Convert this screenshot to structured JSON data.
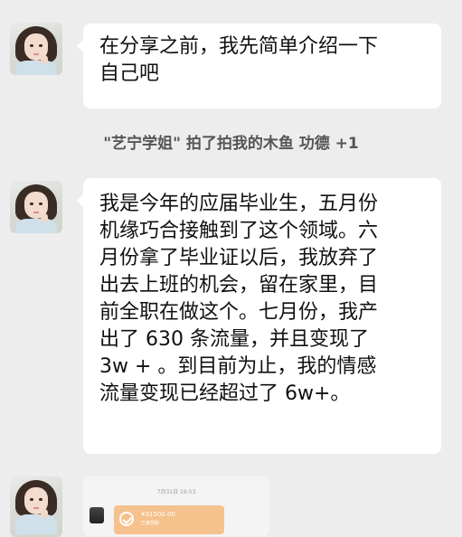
{
  "messages": [
    {
      "sender": "other",
      "lines": [
        "在分享之前，我先简单介绍一下",
        "自己吧"
      ]
    },
    {
      "sender": "other",
      "lines": [
        "我是今年的应届毕业生，五月份",
        "机缘巧合接触到了这个领域。六",
        "月份拿了毕业证以后，我放弃了",
        "出去上班的机会，留在家里，目",
        "前全职在做这个。七月份，我产",
        "出了 630 条流量，并且变现了",
        "3w + 。到目前为止，我的情感",
        "流量变现已经超过了 6w+。"
      ]
    }
  ],
  "system_notice": "\"艺宁学姐\" 拍了拍我的木鱼 功德 +1",
  "transfer_card": {
    "timestamp": "7月31日 19:53",
    "amount": "¥31500.00",
    "status": "已被领取",
    "accent": "#f5c18d"
  },
  "colors": {
    "background": "#ededed",
    "bubble": "#ffffff"
  }
}
